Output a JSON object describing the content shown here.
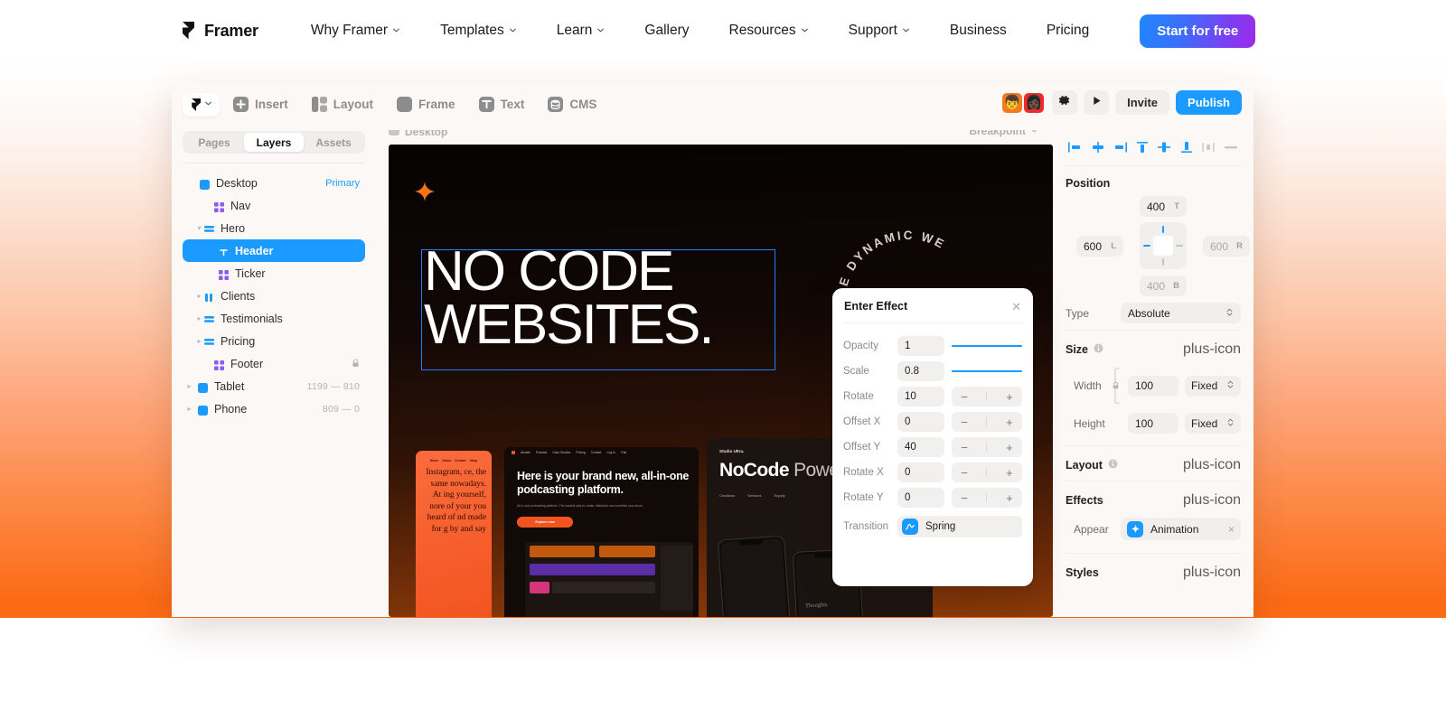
{
  "topnav": {
    "brand": "Framer",
    "links": [
      {
        "label": "Why Framer",
        "caret": true
      },
      {
        "label": "Templates",
        "caret": true
      },
      {
        "label": "Learn",
        "caret": true
      },
      {
        "label": "Gallery",
        "caret": false
      },
      {
        "label": "Resources",
        "caret": true
      },
      {
        "label": "Support",
        "caret": true
      },
      {
        "label": "Business",
        "caret": false
      },
      {
        "label": "Pricing",
        "caret": false
      }
    ],
    "cta": "Start for free",
    "cta_gradient_from": "#1f86fe",
    "cta_gradient_to": "#9a2ce8"
  },
  "toolbar": {
    "items": [
      {
        "label": "Insert",
        "icon": "plus-square-icon"
      },
      {
        "label": "Layout",
        "icon": "layout-columns-icon"
      },
      {
        "label": "Frame",
        "icon": "frame-icon"
      },
      {
        "label": "Text",
        "icon": "text-t-icon"
      },
      {
        "label": "CMS",
        "icon": "database-icon"
      }
    ],
    "avatars": [
      {
        "name": "collaborator-1",
        "emoji": "👦",
        "color": "#f47a20"
      },
      {
        "name": "collaborator-2",
        "emoji": "👩🏿",
        "color": "#ee2b2b"
      }
    ],
    "settings_icon": "gear-icon",
    "preview_icon": "play-icon",
    "invite_label": "Invite",
    "publish_label": "Publish",
    "publish_color": "#1b9bff"
  },
  "left_panel": {
    "tabs": [
      {
        "label": "Pages",
        "active": false
      },
      {
        "label": "Layers",
        "active": true
      },
      {
        "label": "Assets",
        "active": false
      }
    ],
    "layers": [
      {
        "name": "Desktop",
        "indent": 0,
        "icon": "frame-blue-icon",
        "disclosure": "",
        "tag": "Primary",
        "selected": false
      },
      {
        "name": "Nav",
        "indent": 1,
        "icon": "component-icon",
        "disclosure": "",
        "selected": false
      },
      {
        "name": "Hero",
        "indent": 1,
        "icon": "stack-icon",
        "disclosure": "open",
        "selected": false
      },
      {
        "name": "Header",
        "indent": 2,
        "icon": "text-t-icon",
        "disclosure": "",
        "selected": true
      },
      {
        "name": "Ticker",
        "indent": 2,
        "icon": "component-icon",
        "disclosure": "",
        "selected": false
      },
      {
        "name": "Clients",
        "indent": 1,
        "icon": "grid-cols-icon",
        "disclosure": "closed",
        "selected": false
      },
      {
        "name": "Testimonials",
        "indent": 1,
        "icon": "stack-icon",
        "disclosure": "closed",
        "selected": false
      },
      {
        "name": "Pricing",
        "indent": 1,
        "icon": "stack-icon",
        "disclosure": "closed",
        "selected": false
      },
      {
        "name": "Footer",
        "indent": 1,
        "icon": "component-icon",
        "disclosure": "",
        "lock": true,
        "selected": false
      },
      {
        "name": "Tablet",
        "indent": 0,
        "icon": "frame-blue-icon",
        "disclosure": "closed",
        "dim": "1199 — 810",
        "selected": false
      },
      {
        "name": "Phone",
        "indent": 0,
        "icon": "frame-blue-icon",
        "disclosure": "closed",
        "dim": "809 — 0",
        "selected": false
      }
    ]
  },
  "canvas": {
    "frame_label": "Desktop",
    "breakpoint_label": "Breakpoint",
    "hero_line1": "NO CODE",
    "hero_line2": "WEBSITES.",
    "circular_text": "E DYNAMIC WE",
    "card_a": {
      "nav": [
        "Home",
        "About",
        "Contact",
        "Shop"
      ],
      "body": "Instagram, ce, the same nowadays. At ing yourself, nore of your you heard of nd made for g by and say"
    },
    "card_b": {
      "top_brand": "Akustik",
      "top_nav": [
        "Home",
        "Podcast",
        "Case Studies",
        "Pricing",
        "Contact",
        "Log in",
        "Trial"
      ],
      "heading": "Here is your brand new, all-in-one podcasting platform.",
      "paragraph": "All-in-one podcasting platform. The easiest way to create, distribute and monetise your show.",
      "button": "Explore now"
    },
    "card_c": {
      "brand": "Studio Ultra.",
      "heading_bold": "NoCode",
      "heading_rest": " Powerhouse.",
      "nav": [
        "Creations",
        "Services",
        "Supply"
      ],
      "phone_label": "Thoughts"
    }
  },
  "popover": {
    "title": "Enter Effect",
    "close_icon": "close-icon",
    "rows": [
      {
        "label": "Opacity",
        "value": "1",
        "control": "slider"
      },
      {
        "label": "Scale",
        "value": "0.8",
        "control": "slider"
      },
      {
        "label": "Rotate",
        "value": "10",
        "control": "stepper"
      },
      {
        "label": "Offset X",
        "value": "0",
        "control": "stepper"
      },
      {
        "label": "Offset Y",
        "value": "40",
        "control": "stepper"
      },
      {
        "label": "Rotate X",
        "value": "0",
        "control": "stepper"
      },
      {
        "label": "Rotate Y",
        "value": "0",
        "control": "stepper"
      }
    ],
    "transition_label": "Transition",
    "transition_value": "Spring",
    "transition_icon": "spring-curve-icon",
    "minus": "−",
    "plus": "+"
  },
  "right_panel": {
    "align_buttons": [
      {
        "name": "align-left-icon",
        "enabled": true
      },
      {
        "name": "align-horizontal-center-icon",
        "enabled": true
      },
      {
        "name": "align-right-icon",
        "enabled": true
      },
      {
        "name": "align-top-icon",
        "enabled": true
      },
      {
        "name": "align-vertical-center-icon",
        "enabled": true
      },
      {
        "name": "align-bottom-icon",
        "enabled": true
      },
      {
        "name": "distribute-horizontal-icon",
        "enabled": false
      },
      {
        "name": "distribute-vertical-icon",
        "enabled": false
      }
    ],
    "position": {
      "title": "Position",
      "top": "400",
      "top_suffix": "T",
      "left": "600",
      "left_suffix": "L",
      "right": "600",
      "right_suffix": "R",
      "bottom": "400",
      "bottom_suffix": "B",
      "type_label": "Type",
      "type_value": "Absolute"
    },
    "size": {
      "title": "Size",
      "width_label": "Width",
      "width_value": "100",
      "width_mode": "Fixed",
      "height_label": "Height",
      "height_value": "100",
      "height_mode": "Fixed"
    },
    "layout": {
      "title": "Layout"
    },
    "effects": {
      "title": "Effects",
      "row_label": "Appear",
      "row_value": "Animation",
      "row_icon": "sparkle-icon",
      "remove_icon": "close-icon"
    },
    "styles": {
      "title": "Styles"
    },
    "add_icon": "plus-icon",
    "info_icon": "info-icon"
  }
}
